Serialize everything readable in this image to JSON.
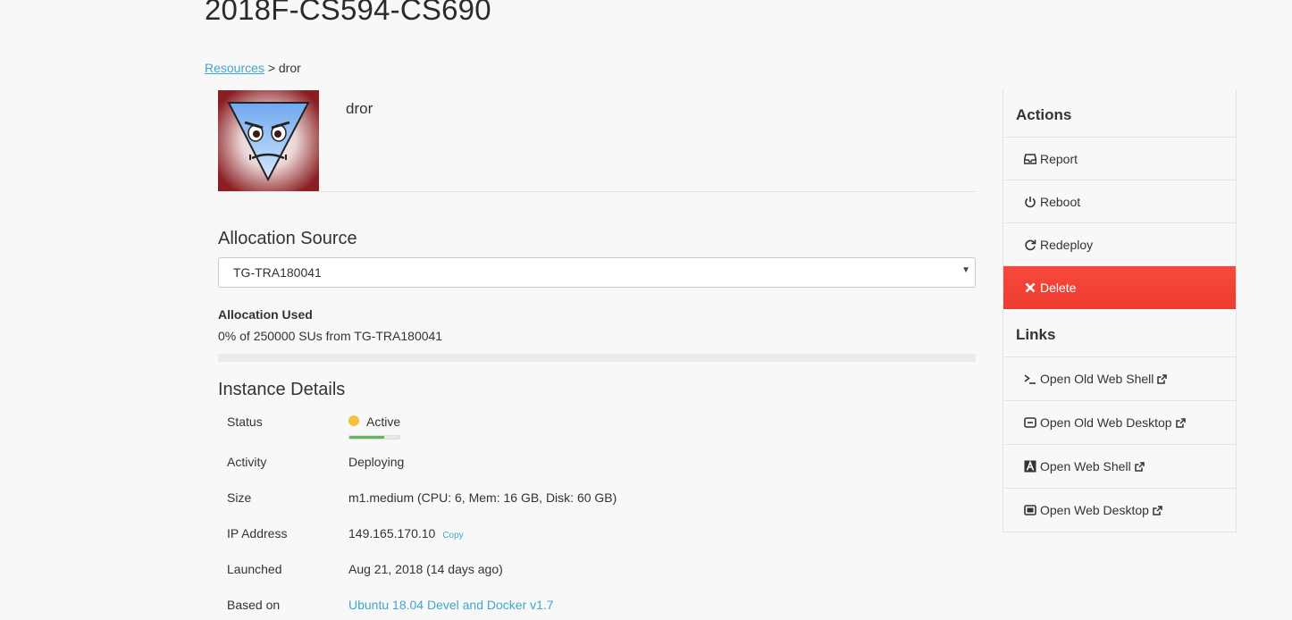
{
  "page": {
    "title": "2018F-CS594-CS690"
  },
  "breadcrumb": {
    "root": "Resources",
    "separator": ">",
    "current": "dror"
  },
  "instance": {
    "name": "dror"
  },
  "allocation": {
    "section_title": "Allocation Source",
    "selected": "TG-TRA180041",
    "used_label": "Allocation Used",
    "used_text": "0% of 250000 SUs from TG-TRA180041",
    "used_percent": 0
  },
  "details": {
    "section_title": "Instance Details",
    "status_label": "Status",
    "status_value": "Active",
    "status_progress_percent": 70,
    "activity_label": "Activity",
    "activity_value": "Deploying",
    "size_label": "Size",
    "size_value": "m1.medium (CPU: 6, Mem: 16 GB, Disk: 60 GB)",
    "ip_label": "IP Address",
    "ip_value": "149.165.170.10",
    "copy_label": "Copy",
    "launched_label": "Launched",
    "launched_value": "Aug 21, 2018 (14 days ago)",
    "based_on_label": "Based on",
    "based_on_value": "Ubuntu 18.04 Devel and Docker v1.7"
  },
  "sidebar": {
    "actions_heading": "Actions",
    "actions": [
      {
        "label": "Report",
        "icon": "inbox-icon"
      },
      {
        "label": "Reboot",
        "icon": "power-icon"
      },
      {
        "label": "Redeploy",
        "icon": "refresh-icon"
      },
      {
        "label": "Delete",
        "icon": "close-icon"
      }
    ],
    "links_heading": "Links",
    "links": [
      {
        "label": "Open Old Web Shell",
        "icon": "terminal-icon"
      },
      {
        "label": "Open Old Web Desktop",
        "icon": "desktop-icon"
      },
      {
        "label": "Open Web Shell",
        "icon": "shell-a-icon"
      },
      {
        "label": "Open Web Desktop",
        "icon": "monitor-icon"
      }
    ]
  },
  "colors": {
    "link": "#3fa7c9",
    "delete_bg": "#f24236",
    "status_dot": "#f6c23e",
    "progress": "#5cb85c"
  }
}
